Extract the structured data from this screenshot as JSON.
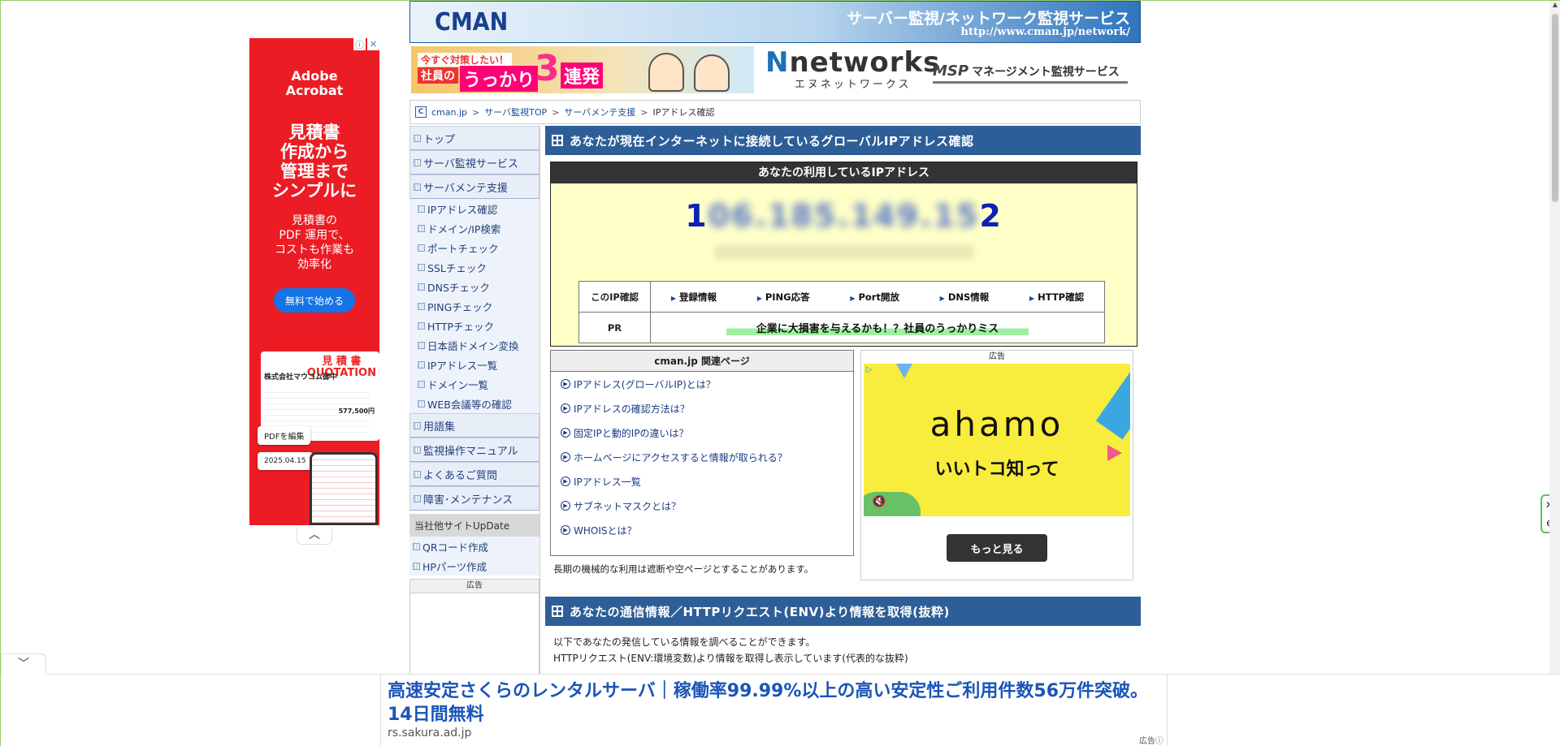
{
  "left_ad": {
    "logo": "Adobe\nAcrobat",
    "headline": "見積書\n作成から\n管理まで\nシンプルに",
    "sub": "見積書の\nPDF 運用で、\nコストも作業も\n効率化",
    "cta": "無料で始める",
    "quote_title": "見 積 書\nQUOTATION",
    "quote_company": "株式会社マウコム御中",
    "quote_amount": "577,500円",
    "pdf_edit": "PDFを編集",
    "date": "2025.04.15",
    "corner_info": "ⓘ",
    "corner_close": "✕",
    "collapse": "︿"
  },
  "header": {
    "logo": "CMAN",
    "title": "サーバー監視/ネットワーク監視サービス",
    "url": "http://www.cman.jp/network/"
  },
  "banner": {
    "ad_line1": "今すぐ対策したい！",
    "ad_line2": "社員の",
    "ad_line3": "うっかり",
    "ad_num": "3",
    "ad_line4": "連発",
    "nnet_pre": "N",
    "nnet_main": "networks",
    "nnet_sub": "エヌネットワークス",
    "msp_abbr": "MSP",
    "msp_text": "マネージメント監視サービス"
  },
  "breadcrumb": {
    "icon": "C",
    "items": [
      "cman.jp",
      "サーバ監視TOP",
      "サーバメンテ支援",
      "IPアドレス確認"
    ],
    "sep": ">"
  },
  "sidebar": {
    "top_items": [
      "トップ",
      "サーバ監視サービス",
      "サーバメンテ支援"
    ],
    "sub_items": [
      "IPアドレス確認",
      "ドメイン/IP検索",
      "ポートチェック",
      "SSLチェック",
      "DNSチェック",
      "PINGチェック",
      "HTTPチェック",
      "日本語ドメイン変換",
      "IPアドレス一覧",
      "ドメイン一覧",
      "WEB会議等の確認"
    ],
    "bottom_items": [
      "用語集",
      "監視操作マニュアル",
      "よくあるご質問",
      "障害･メンテナンス"
    ],
    "other_header": "当社他サイトUpDate",
    "other_items": [
      "QRコード作成",
      "HPパーツ作成"
    ],
    "ad_label": "広告"
  },
  "main": {
    "section1_title": "あなたが現在インターネットに接続しているグローバルIPアドレス確認",
    "ipbox_head": "あなたの利用しているIPアドレス",
    "ip_first": "1",
    "ip_blur": "06.185.149.15",
    "ip_last": "2",
    "row1_label": "このIP確認",
    "row1_links": [
      "登録情報",
      "PING応答",
      "Port開放",
      "DNS情報",
      "HTTP確認"
    ],
    "row2_label": "PR",
    "pr_text": "企業に大損害を与えるかも！？社員のうっかりミス",
    "related_head": "cman.jp 関連ページ",
    "related_items": [
      "IPアドレス(グローバルIP)とは？",
      "IPアドレスの確認方法は？",
      "固定IPと動的IPの違いは？",
      "ホームページにアクセスすると情報が取られる？",
      "IPアドレス一覧",
      "サブネットマスクとは？",
      "WHOISとは？"
    ],
    "related_note": "長期の機械的な利用は遮断や空ページとすることがあります。",
    "ad_label": "広告",
    "ahamo_logo": "ahamo",
    "ahamo_tag": "いいトコ知って",
    "ahamo_mute": "🔇",
    "ad_choice": "▷",
    "more_btn": "もっと見る",
    "section2_title": "あなたの通信情報／HTTPリクエスト(ENV)より情報を取得(抜粋)",
    "section2_line1": "以下であなたの発信している情報を調べることができます。",
    "section2_line2": "HTTPリクエスト(ENV:環境変数)より情報を取得し表示しています(代表的な抜粋)"
  },
  "bottom_ad": {
    "toggle": "﹀",
    "title": "高速安定さくらのレンタルサーバ｜稼働率99.99%以上の高い安定性ご利用件数56万件突破。14日間無料",
    "url": "rs.sakura.ad.jp",
    "tag": "広告ⓘ"
  },
  "float": {
    "close": "✕",
    "e": "e"
  }
}
